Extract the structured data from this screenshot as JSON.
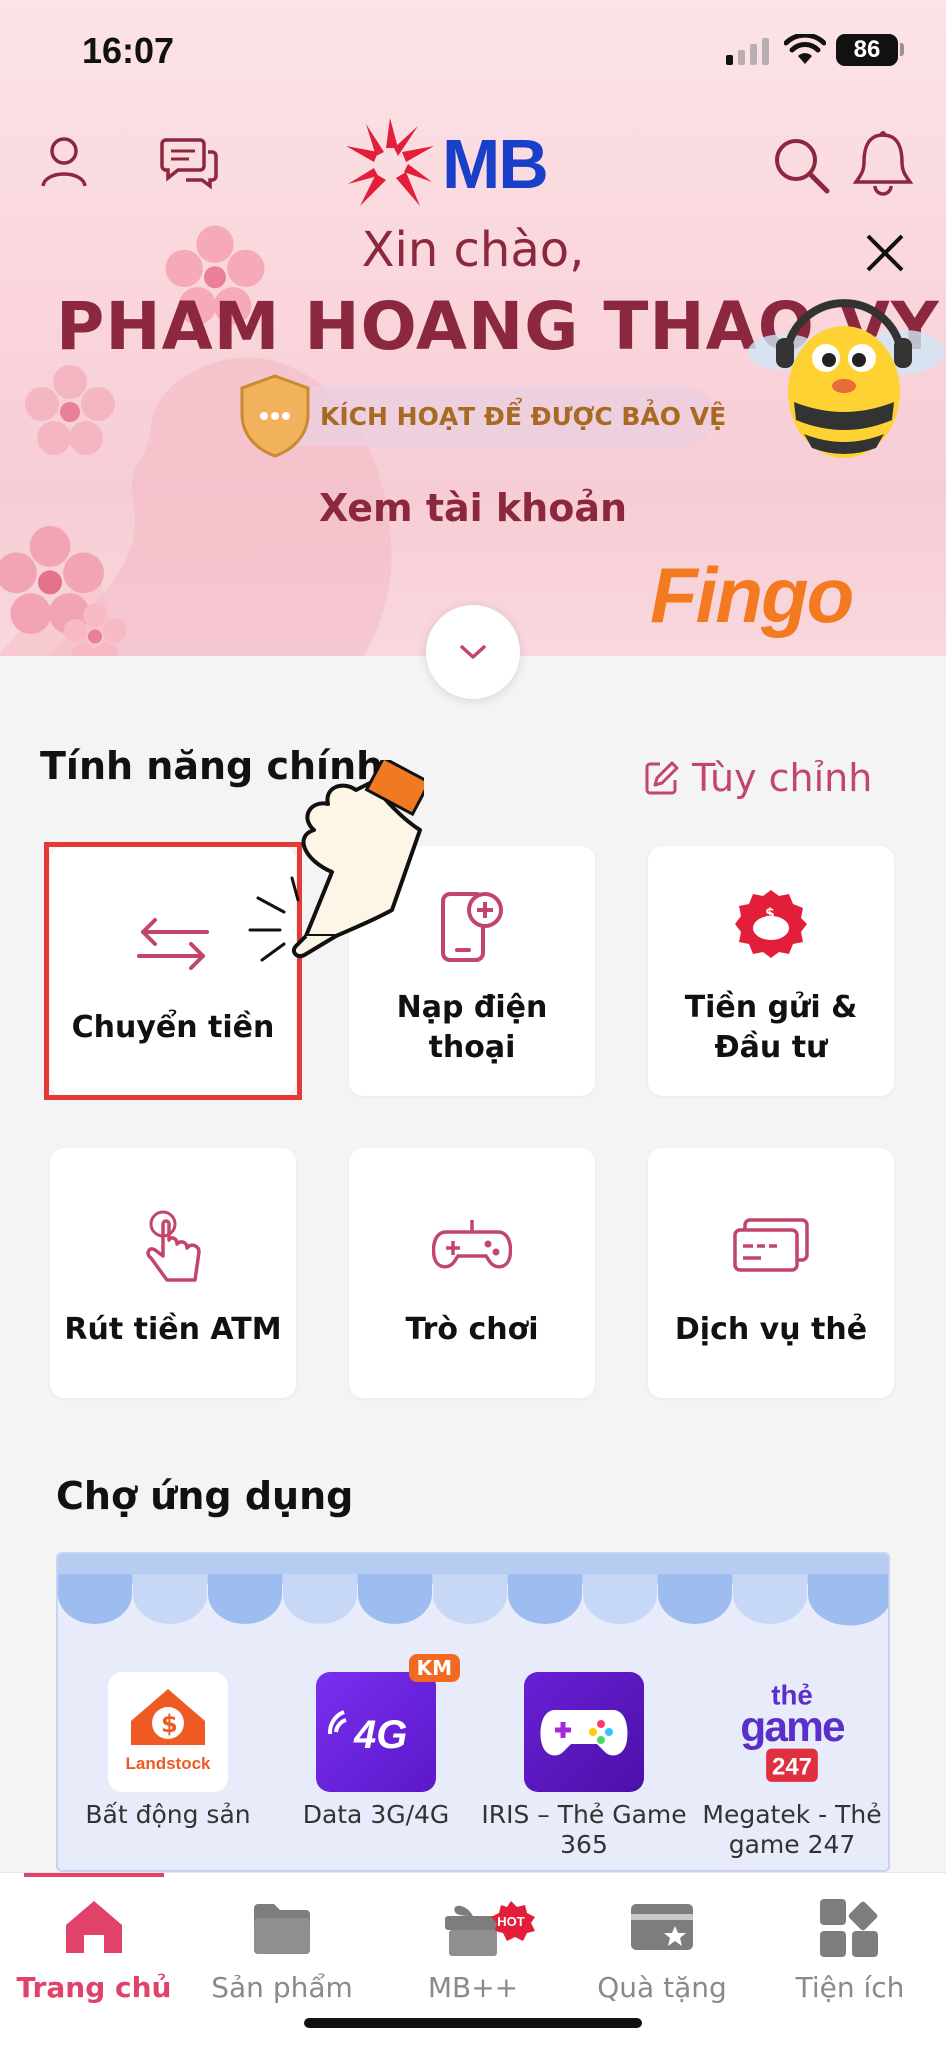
{
  "status_bar": {
    "time": "16:07",
    "battery": "86"
  },
  "header": {
    "brand": "MB",
    "greeting": "Xin chào,",
    "user_name": "PHAM HOANG THAO VY",
    "activate_label": "KÍCH HOẠT ĐỂ ĐƯỢC BẢO VỆ",
    "view_account": "Xem tài khoản",
    "promo_brand": "Fingo"
  },
  "main_features": {
    "title": "Tính năng chính",
    "customize_label": "Tùy chỉnh",
    "items": [
      {
        "label": "Chuyển tiền",
        "icon": "transfer-arrows-icon"
      },
      {
        "label": "Nạp điện thoại",
        "icon": "phone-topup-icon"
      },
      {
        "label": "Tiền gửi & Đầu tư",
        "icon": "piggy-bank-icon"
      },
      {
        "label": "Rút tiền ATM",
        "icon": "tap-finger-icon"
      },
      {
        "label": "Trò chơi",
        "icon": "gamepad-icon"
      },
      {
        "label": "Dịch vụ thẻ",
        "icon": "cards-icon"
      }
    ]
  },
  "app_market": {
    "title": "Chợ ứng dụng",
    "apps": [
      {
        "name": "Bất động sản",
        "icon_text": "Landstock"
      },
      {
        "name": "Data 3G/4G",
        "icon_text": "4G",
        "badge": "KM"
      },
      {
        "name": "IRIS – Thẻ Game 365",
        "icon_text": ""
      },
      {
        "name": "Megatek - Thẻ game 247",
        "icon_text_1": "thẻ",
        "icon_text_2": "game",
        "icon_text_3": "247"
      }
    ]
  },
  "bottom_nav": {
    "items": [
      {
        "label": "Trang chủ",
        "active": true
      },
      {
        "label": "Sản phẩm"
      },
      {
        "label": "MB++",
        "badge": "HOT"
      },
      {
        "label": "Quà tặng"
      },
      {
        "label": "Tiện ích"
      }
    ]
  },
  "colors": {
    "brand_blue": "#1a3fc9",
    "accent_pink": "#e0426a",
    "title_maroon": "#8c2740",
    "fingo_orange": "#f47a22"
  }
}
